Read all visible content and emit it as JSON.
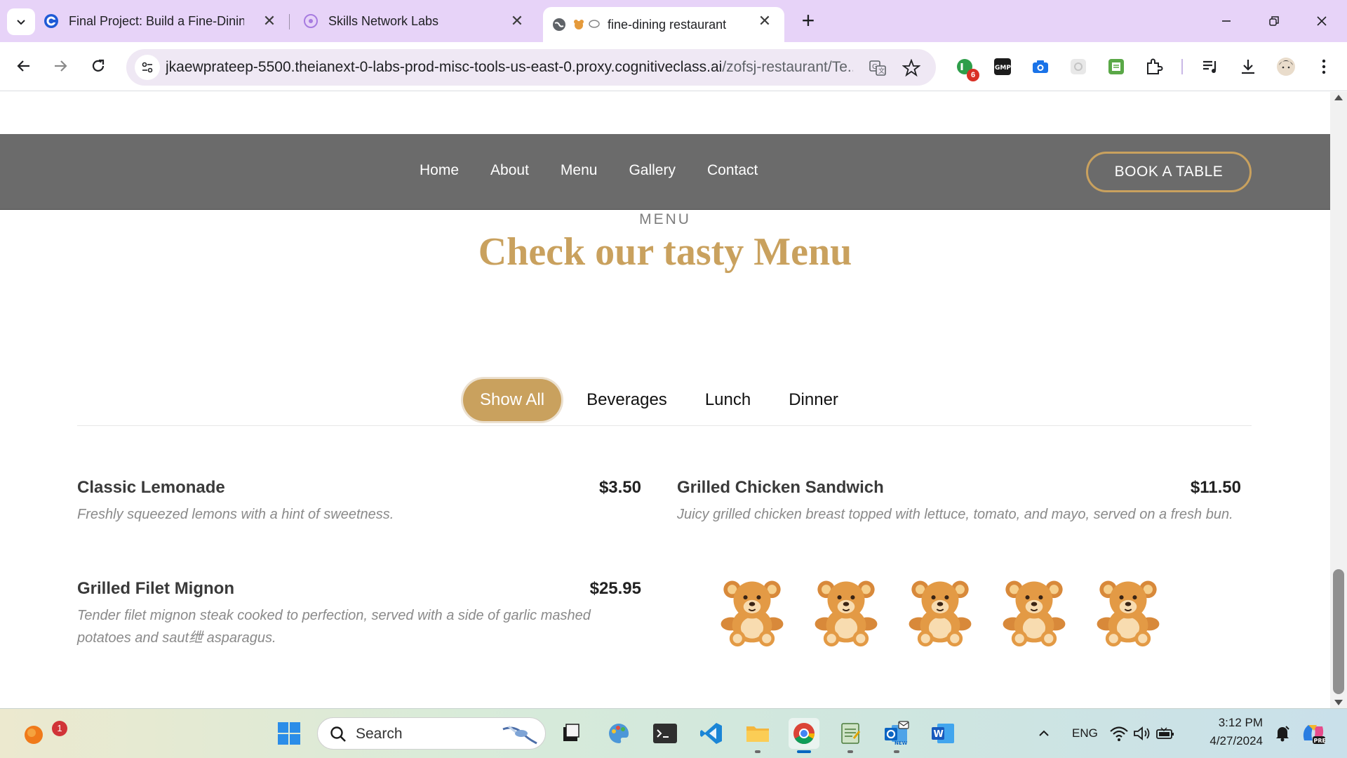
{
  "browser": {
    "tabs": [
      {
        "title": "Final Project: Build a Fine-Dinin",
        "close": "✕"
      },
      {
        "title": "Skills Network Labs",
        "close": "✕"
      },
      {
        "title": "fine-dining restaurant",
        "close": "✕"
      }
    ],
    "new_tab": "+",
    "url_host": "jkaewprateep-5500.theianext-0-labs-prod-misc-tools-us-east-0.proxy.cognitiveclass.ai",
    "url_path": "/zofsj-restaurant/Te...",
    "extension_badge": "6"
  },
  "site": {
    "nav": [
      "Home",
      "About",
      "Menu",
      "Gallery",
      "Contact"
    ],
    "book_button": "BOOK A TABLE",
    "section_eyebrow": "MENU",
    "section_title": "Check our tasty Menu",
    "filters": [
      "Show All",
      "Beverages",
      "Lunch",
      "Dinner"
    ],
    "active_filter": "Show All",
    "items": [
      {
        "name": "Classic Lemonade",
        "price": "$3.50",
        "description": "Freshly squeezed lemons with a hint of sweetness."
      },
      {
        "name": "Grilled Chicken Sandwich",
        "price": "$11.50",
        "description": "Juicy grilled chicken breast topped with lettuce, tomato, and mayo, served on a fresh bun."
      },
      {
        "name": "Grilled Filet Mignon",
        "price": "$25.95",
        "description": "Tender filet mignon steak cooked to perfection, served with a side of garlic mashed potatoes and saut绁 asparagus."
      }
    ],
    "bear_count": 5
  },
  "taskbar": {
    "search_placeholder": "Search",
    "notification_count": "1",
    "language": "ENG",
    "time": "3:12 PM",
    "date": "4/27/2024"
  },
  "colors": {
    "accent_gold": "#c9a15e",
    "nav_gray": "#6b6b6b",
    "tab_strip": "#e7d3f8"
  }
}
